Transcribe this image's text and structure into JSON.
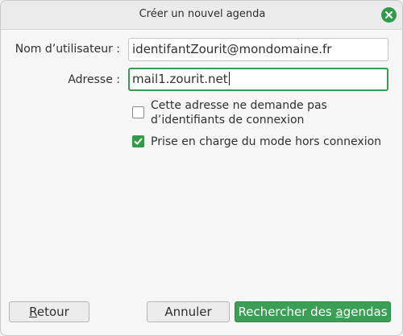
{
  "window": {
    "title": "Créer un nouvel agenda",
    "close_icon": "close-icon"
  },
  "form": {
    "username_label": "Nom d’utilisateur :",
    "username_value": "identifantZourit@mondomaine.fr",
    "address_label": "Adresse :",
    "address_value": "mail1.zourit.net"
  },
  "options": {
    "no_credentials": {
      "line1": "Cette adresse ne demande pas",
      "line2": "d’identifiants de connexion",
      "checked": false
    },
    "offline_support": {
      "label": "Prise en charge du mode hors connexion",
      "checked": true
    }
  },
  "buttons": {
    "back": {
      "mnemonic": "R",
      "rest": "etour"
    },
    "cancel": "Annuler",
    "search": {
      "prefix": "Rechercher des ",
      "mnemonic": "a",
      "rest": "gendas"
    }
  },
  "colors": {
    "accent": "#3a9f54",
    "focus_border": "#3a9a52"
  }
}
